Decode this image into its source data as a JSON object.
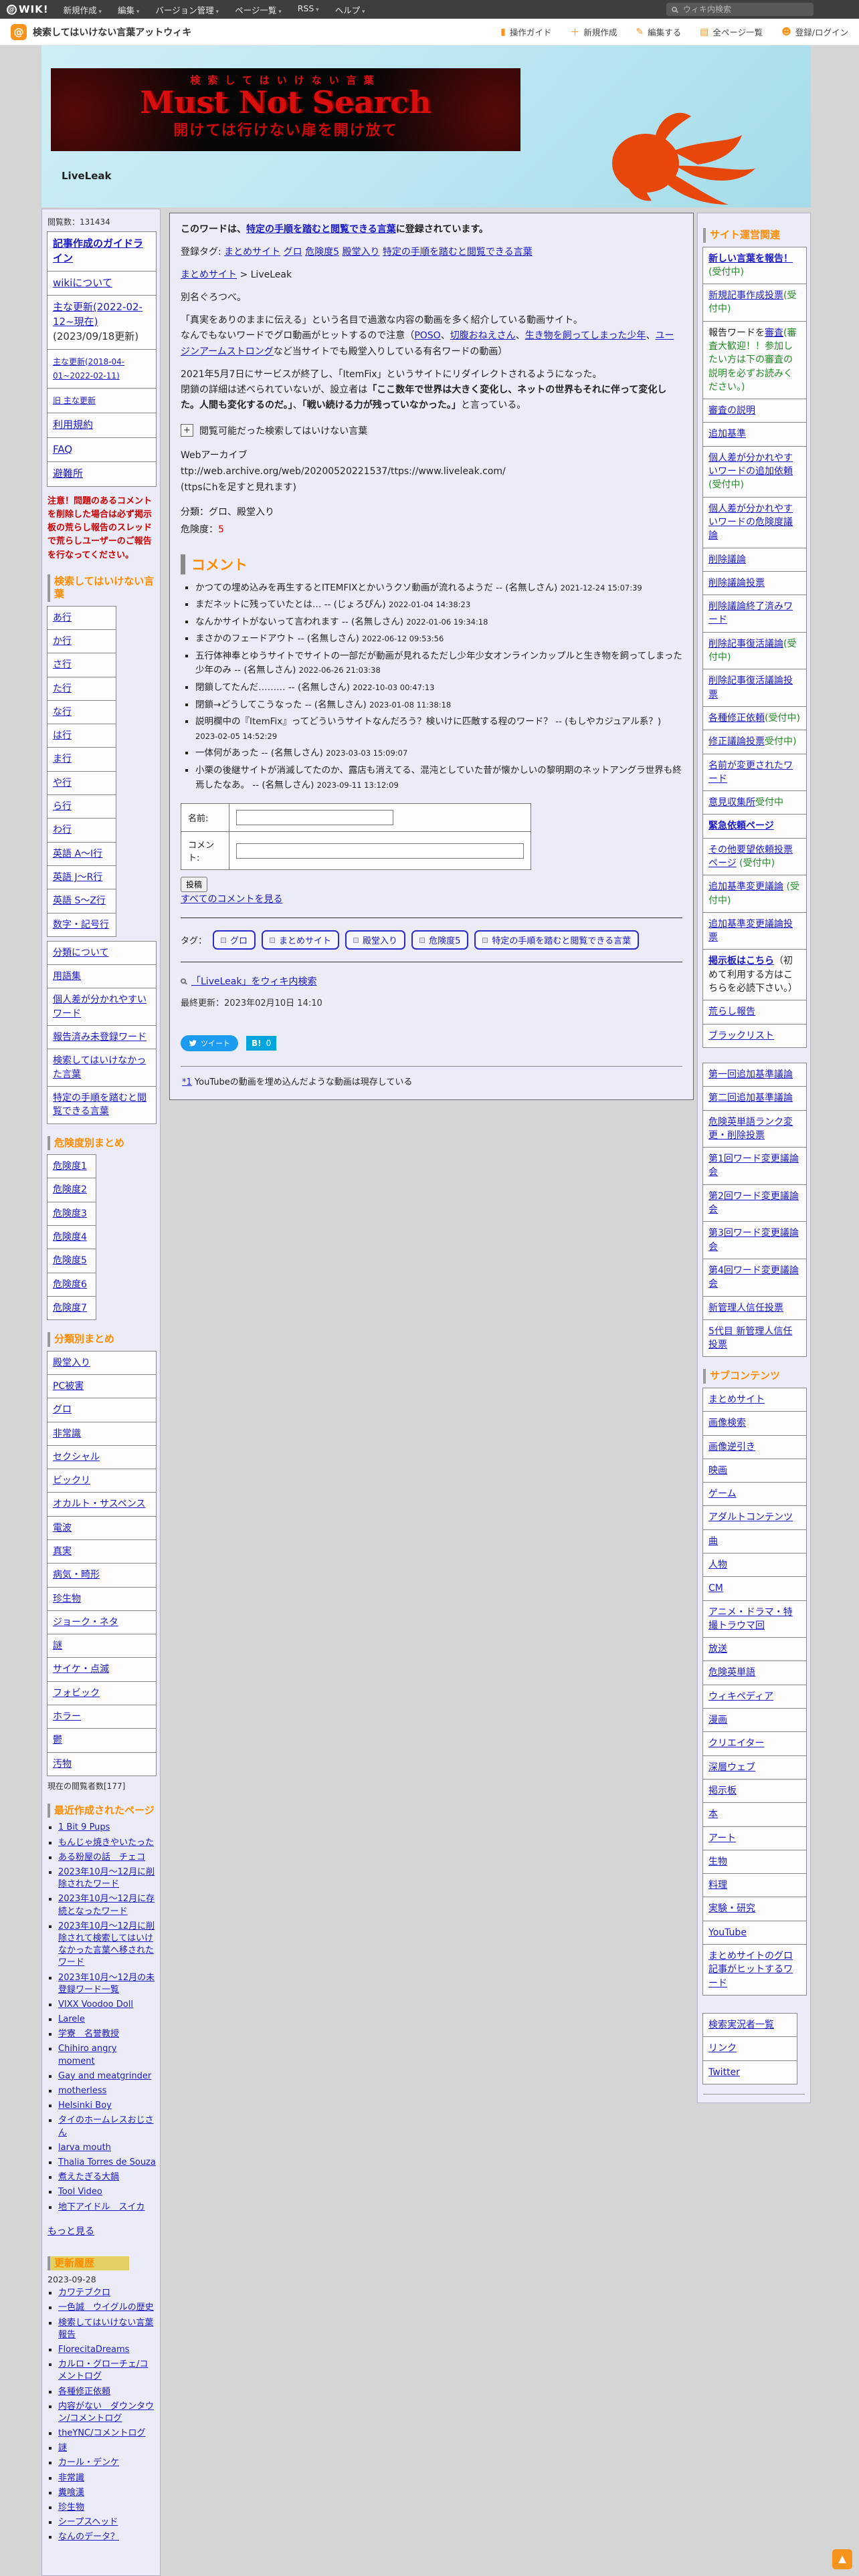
{
  "colors": {
    "accent_orange": "#f7941e",
    "heading_orange": "#ff8c00",
    "link_blue": "#1a1ac4",
    "danger_red": "#d40000",
    "notice_red": "#c80000",
    "green_note": "#1f8a1f",
    "twitter_blue": "#1d9bf0",
    "hatena_blue": "#00a5de",
    "banner_red": "#d90f0f",
    "banner_bg": "#b9e6f0"
  },
  "topbar": {
    "logo": "@WIK!",
    "menus": [
      "新規作成",
      "編集",
      "バージョン管理",
      "ページ一覧",
      "RSS",
      "ヘルプ"
    ],
    "search_placeholder": "ウィキ内検索"
  },
  "header": {
    "site_title": "検索してはいけない言葉アットウィキ",
    "actions": [
      {
        "glyph": "▮",
        "label": "操作ガイド"
      },
      {
        "glyph": "＋",
        "label": "新規作成"
      },
      {
        "glyph": "✎",
        "label": "編集する"
      },
      {
        "glyph": "▤",
        "label": "全ページ一覧"
      },
      {
        "glyph": "☻",
        "label": "登録/ログイン"
      }
    ]
  },
  "banner": {
    "line1": "検索してはいけない言葉",
    "line2": "Must Not Search",
    "line3": "開けては行けない扉を開け放て",
    "page_title": "LiveLeak"
  },
  "left_sidebar": {
    "views_label": "閲覧数：131434",
    "menu": [
      {
        "link": "記事作成のガイドライン",
        "cls": "b"
      },
      {
        "link": "wikiについて"
      },
      {
        "link": "主な更新(2022-02-12~現在)",
        "plain": "(2023/09/18更新)"
      },
      {
        "link": "主な更新(2018-04-01~2022-02-11)",
        "cls": "sm"
      },
      {
        "link": "旧 主な更新",
        "cls": "sm"
      },
      {
        "link": "利用規約"
      },
      {
        "link": "FAQ"
      },
      {
        "link": "避難所"
      }
    ],
    "notice": "注意！問題のあるコメントを削除した場合は必ず掲示板の荒らし報告のスレッドで荒らしユーザーのご報告を行なってください。",
    "section1_title": "検索してはいけない言葉",
    "kana_rows": [
      "あ行",
      "か行",
      "さ行",
      "た行",
      "な行",
      "は行",
      "ま行",
      "や行",
      "ら行",
      "わ行",
      "英語 A～I行",
      "英語 J～R行",
      "英語 S～Z行",
      "数字・記号行"
    ],
    "misc_links": [
      "分類について",
      "用語集",
      "個人差が分かれやすいワード",
      "報告済み未登録ワード",
      "検索してはいけなかった言葉",
      "特定の手順を踏むと閲覧できる言葉"
    ],
    "danger_title": "危険度別まとめ",
    "danger_links": [
      "危険度1",
      "危険度2",
      "危険度3",
      "危険度4",
      "危険度5",
      "危険度6",
      "危険度7"
    ],
    "category_title": "分類別まとめ",
    "category_links": [
      "殿堂入り",
      "PC被害",
      "グロ",
      "非常識",
      "セクシャル",
      "ビックリ",
      "オカルト・サスペンス",
      "電波",
      "真実",
      "病気・畸形",
      "珍生物",
      "ジョーク・ネタ",
      "謎",
      "サイケ・点滅",
      "フォビック",
      "ホラー",
      "鬱",
      "汚物"
    ],
    "viewers_label": "現在の閲覧者数[177]",
    "recent_title": "最近作成されたページ",
    "recent_pages": [
      "1 Bit 9 Pups",
      "もんじゃ焼きやいたった",
      "ある粉屋の話　チェコ",
      "2023年10月～12月に削除されたワード",
      "2023年10月～12月に存続となったワード",
      "2023年10月～12月に削除されて検索してはいけなかった言葉へ移されたワード",
      "2023年10月～12月の未登録ワード一覧",
      "VIXX Voodoo Doll",
      "Larele",
      "学寮　名誉教授",
      "Chihiro angry moment",
      "Gay and meatgrinder",
      "motherless",
      "Helsinki Boy",
      "タイのホームレスおじさん",
      "larva mouth",
      "Thalia Torres de Souza",
      "煮えたぎる大鍋",
      "Tool Video",
      "地下アイドル　スイカ"
    ],
    "more_link": "もっと見る",
    "history_title": "更新履歴",
    "history_date": "2023-09-28",
    "history_items": [
      "カワテブクロ",
      "一色誠　ウイグルの歴史",
      "検索してはいけない言葉報告",
      "FlorecitaDreams",
      "カルロ・グローチェ/コメントログ",
      "各種修正依頼",
      "内容がない　ダウンタウン/コメントログ",
      "theYNC/コメントログ",
      "謎",
      "カール・デンケ",
      "非常識",
      "糞喰漢",
      "珍生物",
      "シープスヘッド",
      "なんのデータ？"
    ]
  },
  "main": {
    "registered_note": [
      {
        "t": "このワードは、"
      },
      {
        "l": "特定の手順を踏むと閲覧できる言葉"
      },
      {
        "t": "に登録されています。"
      }
    ],
    "reg_tags_line": [
      {
        "t": "登録タグ: "
      },
      {
        "l": "まとめサイト"
      },
      {
        "t": " "
      },
      {
        "l": "グロ"
      },
      {
        "t": " "
      },
      {
        "l": "危険度5"
      },
      {
        "t": " "
      },
      {
        "l": "殿堂入り"
      },
      {
        "t": " "
      },
      {
        "l": "特定の手順を踏むと閲覧できる言葉"
      }
    ],
    "breadcrumb": [
      {
        "l": "まとめサイト"
      },
      {
        "t": " > LiveLeak"
      }
    ],
    "alias": "別名ぐろつべ。",
    "p1": "「真実をありのままに伝える」という名目で過激な内容の動画を多く紹介している動画サイト。",
    "p2": [
      {
        "t": "なんでもないワードでグロ動画がヒットするので注意（"
      },
      {
        "l": "POSO"
      },
      {
        "t": "、"
      },
      {
        "l": "切腹おねえさん"
      },
      {
        "t": "、"
      },
      {
        "l": "生き物を飼ってしまった少年"
      },
      {
        "t": "、"
      },
      {
        "l": "ユージンアームストロング"
      },
      {
        "t": "など当サイトでも殿堂入りしている有名ワードの動画）"
      }
    ],
    "p3": "2021年5月7日にサービスが終了し、「ItemFix」というサイトにリダイレクトされるようになった。",
    "p4": [
      {
        "t": "閉鎖の詳細は述べられていないが、設立者は"
      },
      {
        "b": "「ここ数年で世界は大きく変化し、ネットの世界もそれに伴って変化した。人間も変化するのだ。」"
      },
      {
        "t": "、"
      },
      {
        "b": "「戦い続ける力が残っていなかった。」"
      },
      {
        "t": "と言っている。"
      }
    ],
    "collapsible_button": "+",
    "collapsible_label": "閲覧可能だった検索してはいけない言葉",
    "archive_title": "Webアーカイブ",
    "archive_url": "ttp://web.archive.org/web/20200520221537/ttps://www.liveleak.com/",
    "archive_note": "(ttpsにhを足すと見れます)",
    "class_label": "分類：グロ、殿堂入り",
    "danger_label": "危険度：",
    "danger_value": "5",
    "comments_title": "コメント",
    "comments": [
      {
        "text": "かつての埋め込みを再生するとITEMFIXとかいうクソ動画が流れるようだ",
        "author": "-- (名無しさん)",
        "time": "2021-12-24 15:07:39"
      },
      {
        "text": "まだネットに残っていたとは…",
        "author": "-- (じょろぴん)",
        "time": "2022-01-04 14:38:23"
      },
      {
        "text": "なんかサイトがないって言われます",
        "author": "-- (名無しさん)",
        "time": "2022-01-06 19:34:18"
      },
      {
        "text": "まさかのフェードアウト",
        "author": "-- (名無しさん)",
        "time": "2022-06-12 09:53:56"
      },
      {
        "text": "五行体神奉とゆうサイトでサイトの一部だが動画が見れるただし少年少女オンラインカップルと生き物を飼ってしまった少年のみ",
        "author": "-- (名無しさん)",
        "time": "2022-06-26 21:03:38"
      },
      {
        "text": "閉鎖してたんだ………",
        "author": "-- (名無しさん)",
        "time": "2022-10-03 00:47:13"
      },
      {
        "text": "閉鎖→どうしてこうなった",
        "author": "-- (名無しさん)",
        "time": "2023-01-08 11:38:18"
      },
      {
        "text": "説明欄中の『ItemFix』ってどういうサイトなんだろう？検いけに匹敵する程のワード？",
        "author": "-- (もしやカジュアル系？)",
        "time": "2023-02-05 14:52:29"
      },
      {
        "text": "一体何があった",
        "author": "-- (名無しさん)",
        "time": "2023-03-03 15:09:07"
      },
      {
        "text": "小栗の後継サイトが消滅してたのか、露店も消えてる、混沌としていた昔が懐かしいの黎明期のネットアングラ世界も終焉したなあ。",
        "author": "-- (名無しさん)",
        "time": "2023-09-11 13:12:09"
      }
    ],
    "form": {
      "name_label": "名前:",
      "comment_label": "コメント:",
      "submit_label": "投稿",
      "all_comments_link": "すべてのコメントを見る"
    },
    "tag_row_label": "タグ：",
    "tag_buttons": [
      "グロ",
      "まとめサイト",
      "殿堂入り",
      "危険度5",
      "特定の手順を踏むと閲覧できる言葉"
    ],
    "wiki_search_link": "「LiveLeak」をウィキ内検索",
    "last_updated": "最終更新：2023年02月10日 14:10",
    "tweet_label": "ツイート",
    "hatena_label": "B!",
    "hatena_count": "0",
    "footnote_ref": "*1",
    "footnote_text": "YouTubeの動画を埋め込んだような動画は現存している"
  },
  "right_sidebar": {
    "ops_title": "サイト運営関連",
    "ops": [
      {
        "link": "新しい言葉を報告！",
        "note": "(受付中)",
        "cls": "b"
      },
      {
        "link": "新規記事作成投票",
        "note": "(受付中)"
      },
      {
        "pre": "報告ワードを",
        "link": "審査",
        "note": "(審査大歓迎！！参加したい方は下の審査の説明を必ずお読みください。)"
      },
      {
        "link": "審査の説明"
      },
      {
        "link": "追加基準"
      },
      {
        "link": "個人差が分かれやすいワードの追加依頼",
        "note": "(受付中)"
      },
      {
        "link": "個人差が分かれやすいワードの危険度議論"
      },
      {
        "link": "削除議論"
      },
      {
        "link": "削除議論投票"
      },
      {
        "link": "削除議論終了済みワード"
      },
      {
        "link": "削除記事復活議論",
        "note": "(受付中)"
      },
      {
        "link": "削除記事復活議論投票"
      },
      {
        "link": "各種修正依頼",
        "note": "(受付中)"
      },
      {
        "link": "修正議論投票",
        "note": "受付中)"
      },
      {
        "link": "名前が変更されたワード"
      },
      {
        "link": "意見収集所",
        "note": "受付中"
      },
      {
        "link": "緊急依頼ページ",
        "cls": "b"
      },
      {
        "link": "その他要望依頼投票ページ",
        "note": " (受付中)"
      },
      {
        "link": "追加基準変更議論",
        "note": " (受付中)"
      },
      {
        "link": "追加基準変更議論投票"
      },
      {
        "link": "掲示板はこちら",
        "plain": "（初めて利用する方はこちらを必読下さい。）",
        "cls": "b"
      },
      {
        "link": "荒らし報告"
      },
      {
        "link": "ブラックリスト"
      }
    ],
    "discussions": [
      "第一回追加基準議論",
      "第二回追加基準議論",
      "危険英単語ランク変更・削除投票",
      "第1回ワード変更議論会",
      "第2回ワード変更議論会",
      "第3回ワード変更議論会",
      "第4回ワード変更議論会",
      "新管理人信任投票",
      "5代目 新管理人信任投票"
    ],
    "sub_title": "サブコンテンツ",
    "subcontents": [
      "まとめサイト",
      "画像検索",
      "画像逆引き",
      "映画",
      "ゲーム",
      "アダルトコンテンツ",
      "曲",
      "人物",
      "CM",
      "アニメ・ドラマ・特撮トラウマ回",
      "放送",
      "危険英単語",
      "ウィキペディア",
      "漫画",
      "クリエイター",
      "深層ウェブ",
      "掲示板",
      "本",
      "アート",
      "生物",
      "料理",
      "実験・研究",
      "YouTube",
      "まとめサイトのグロ記事がヒットするワード"
    ],
    "footer_links": [
      "検索実況者一覧",
      "リンク",
      "Twitter"
    ]
  },
  "scroll_top_glyph": "▲"
}
